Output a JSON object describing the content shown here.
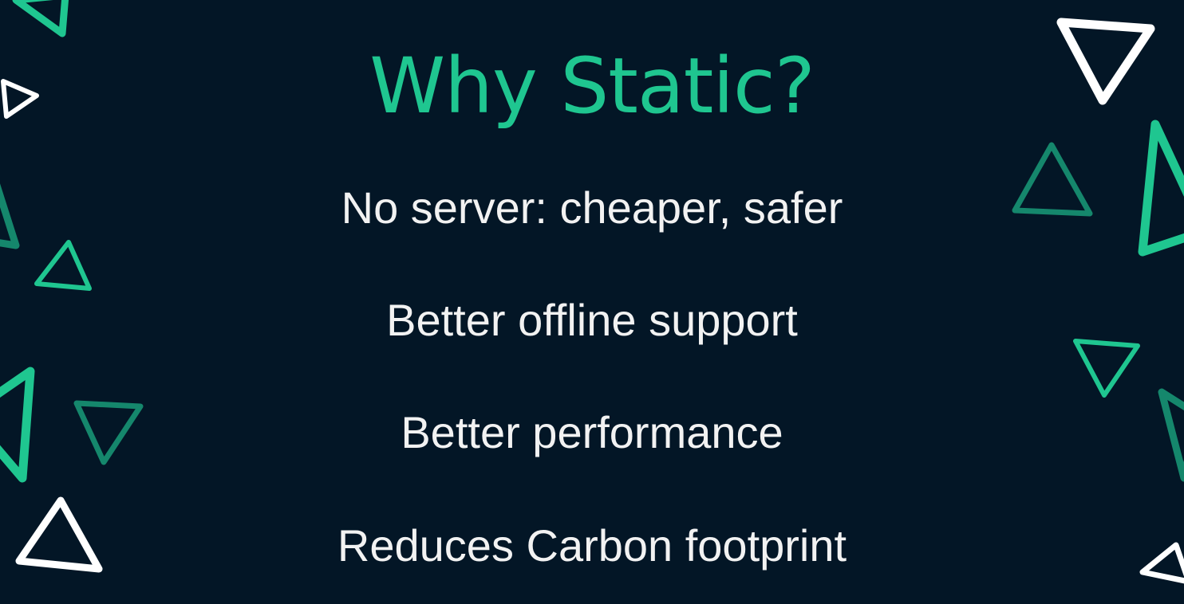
{
  "slide": {
    "title": "Why Static?",
    "bullets": [
      "No server: cheaper, safer",
      "Better offline support",
      "Better performance",
      "Reduces Carbon footprint"
    ]
  },
  "colors": {
    "background": "#031626",
    "title": "#1fc690",
    "text": "#f2f2f2",
    "accent_green": "#1fc690",
    "accent_teal": "#15876c",
    "outline_white": "#ffffff"
  },
  "decorations": {
    "shape": "triangle-outline-icon"
  }
}
